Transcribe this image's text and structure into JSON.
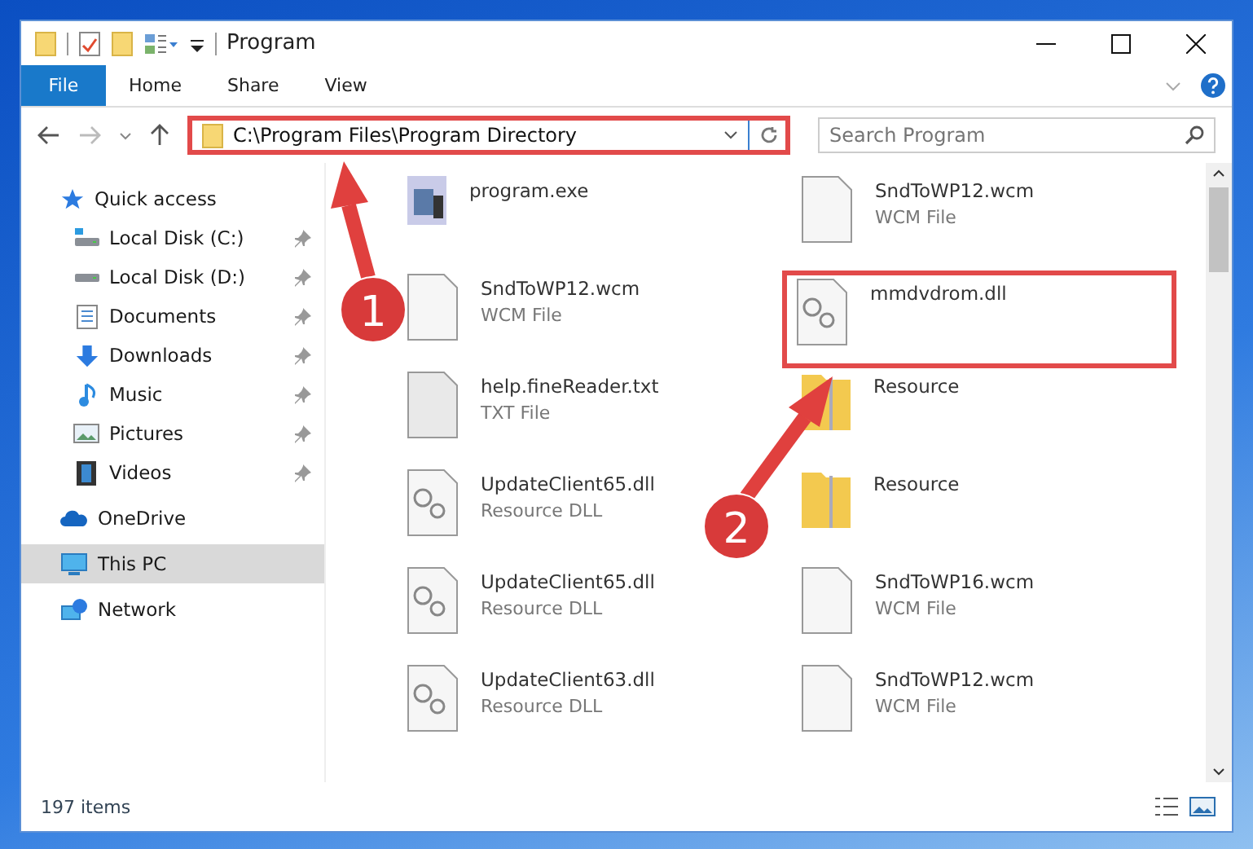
{
  "window": {
    "title": "Program"
  },
  "ribbon_tabs": [
    {
      "label": "File",
      "selected": true
    },
    {
      "label": "Home",
      "selected": false
    },
    {
      "label": "Share",
      "selected": false
    },
    {
      "label": "View",
      "selected": false
    }
  ],
  "address_bar": {
    "path": "C:\\Program Files\\Program Directory",
    "outlined": true
  },
  "search": {
    "placeholder": "Search Program"
  },
  "sidebar": {
    "items": [
      {
        "label": "Quick access",
        "kind": "star",
        "selected": false,
        "children": [
          {
            "label": "Local Disk (C:)",
            "kind": "system-disk",
            "pinned": true
          },
          {
            "label": "Local Disk (D:)",
            "kind": "disk",
            "pinned": true
          },
          {
            "label": "Documents",
            "kind": "document",
            "pinned": true
          },
          {
            "label": "Downloads",
            "kind": "download",
            "pinned": true
          },
          {
            "label": "Music",
            "kind": "music",
            "pinned": true
          },
          {
            "label": "Pictures",
            "kind": "pictures",
            "pinned": true
          },
          {
            "label": "Videos",
            "kind": "videos",
            "pinned": true
          }
        ]
      },
      {
        "label": "OneDrive",
        "kind": "cloud",
        "selected": false
      },
      {
        "label": "This PC",
        "kind": "pc",
        "selected": true
      },
      {
        "label": "Network",
        "kind": "network",
        "selected": false
      }
    ]
  },
  "files": [
    {
      "name": "program.exe",
      "kind": "exe",
      "outlined": false
    },
    {
      "name": "SndToWP12.wcm",
      "type": "WCM File",
      "kind": "file",
      "outlined": false
    },
    {
      "name": "SndToWP12.wcm",
      "type": "WCM File",
      "kind": "file",
      "outlined": false
    },
    {
      "name": "mmdvdrom.dll",
      "kind": "dll",
      "outlined": true
    },
    {
      "name": "help.fineReader.txt",
      "type": "TXT File",
      "kind": "txt",
      "outlined": false
    },
    {
      "name": "Resource",
      "kind": "folder",
      "outlined": false
    },
    {
      "name": "UpdateClient65.dll",
      "type": "Resource DLL",
      "kind": "dll",
      "outlined": false
    },
    {
      "name": "Resource",
      "kind": "folder",
      "outlined": false
    },
    {
      "name": "UpdateClient65.dll",
      "type": "Resource DLL",
      "kind": "dll",
      "outlined": false
    },
    {
      "name": "SndToWP16.wcm",
      "type": "WCM File",
      "kind": "file",
      "outlined": false
    },
    {
      "name": "UpdateClient63.dll",
      "type": "Resource DLL",
      "kind": "dll",
      "outlined": false
    },
    {
      "name": "SndToWP12.wcm",
      "type": "WCM File",
      "kind": "file",
      "outlined": false
    }
  ],
  "annotations": [
    {
      "number": "1"
    },
    {
      "number": "2"
    }
  ],
  "status_bar": {
    "count": "197 items"
  }
}
